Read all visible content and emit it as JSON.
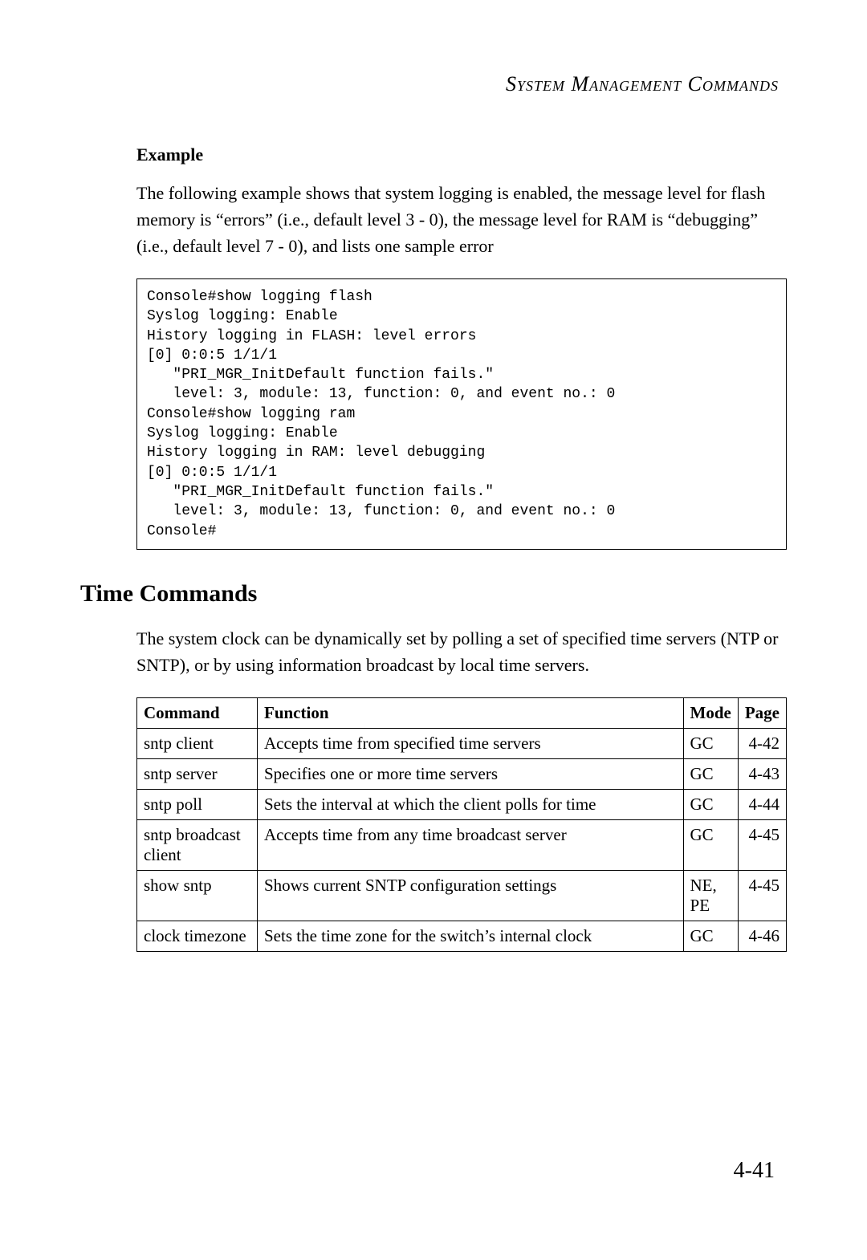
{
  "running_header": "System Management Commands",
  "example": {
    "heading": "Example",
    "body": "The following example shows that system logging is enabled, the message level for flash memory is “errors” (i.e., default level 3 - 0), the message level for RAM is “debugging” (i.e., default level 7 - 0), and lists one sample error",
    "code": "Console#show logging flash\nSyslog logging: Enable\nHistory logging in FLASH: level errors\n[0] 0:0:5 1/1/1\n   \"PRI_MGR_InitDefault function fails.\"\n   level: 3, module: 13, function: 0, and event no.: 0\nConsole#show logging ram\nSyslog logging: Enable\nHistory logging in RAM: level debugging\n[0] 0:0:5 1/1/1\n   \"PRI_MGR_InitDefault function fails.\"\n   level: 3, module: 13, function: 0, and event no.: 0\nConsole#"
  },
  "section": {
    "heading": "Time Commands",
    "body": "The system clock can be dynamically set by polling a set of specified time servers (NTP or SNTP), or by using information broadcast by local time servers."
  },
  "table": {
    "headers": {
      "command": "Command",
      "function": "Function",
      "mode": "Mode",
      "page": "Page"
    },
    "rows": [
      {
        "command": "sntp client",
        "function": "Accepts time from specified time servers",
        "mode": "GC",
        "page": "4-42"
      },
      {
        "command": "sntp server",
        "function": "Specifies one or more time servers",
        "mode": "GC",
        "page": "4-43"
      },
      {
        "command": "sntp poll",
        "function": "Sets the interval at which the client polls for time",
        "mode": "GC",
        "page": "4-44"
      },
      {
        "command": "sntp broadcast client",
        "function": "Accepts time from any time broadcast server",
        "mode": "GC",
        "page": "4-45"
      },
      {
        "command": "show sntp",
        "function": "Shows current SNTP configuration settings",
        "mode": "NE, PE",
        "page": "4-45"
      },
      {
        "command": "clock timezone",
        "function": "Sets the time zone for the switch’s internal clock",
        "mode": "GC",
        "page": "4-46"
      }
    ]
  },
  "page_number": "4-41"
}
